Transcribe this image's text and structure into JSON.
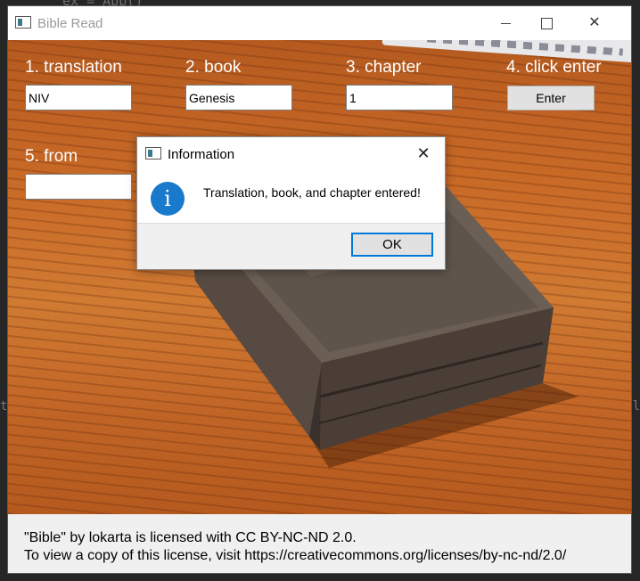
{
  "background_ide": {
    "code_top": "ex = App()",
    "code_left": "t",
    "code_right": "ol"
  },
  "window": {
    "title": "Bible Read",
    "controls": {
      "minimize": "",
      "maximize": "",
      "close": "✕"
    }
  },
  "form": {
    "translation": {
      "label": "1. translation",
      "value": "NIV"
    },
    "book": {
      "label": "2. book",
      "value": "Genesis"
    },
    "chapter": {
      "label": "3. chapter",
      "value": "1"
    },
    "enter": {
      "label": "4. click enter",
      "button": "Enter"
    },
    "from": {
      "label": "5. from",
      "value": ""
    }
  },
  "footer": {
    "line1": "\"Bible\" by lokarta is licensed with CC BY-NC-ND 2.0.",
    "line2": "To view a copy of this license, visit https://creativecommons.org/licenses/by-nc-nd/2.0/"
  },
  "dialog": {
    "title": "Information",
    "close": "✕",
    "icon": "i",
    "message": "Translation, book, and chapter entered!",
    "ok": "OK"
  },
  "colors": {
    "accent": "#0078d7",
    "info_icon": "#1979ca",
    "wood": "#c96a27",
    "label_text": "#ffffff"
  }
}
